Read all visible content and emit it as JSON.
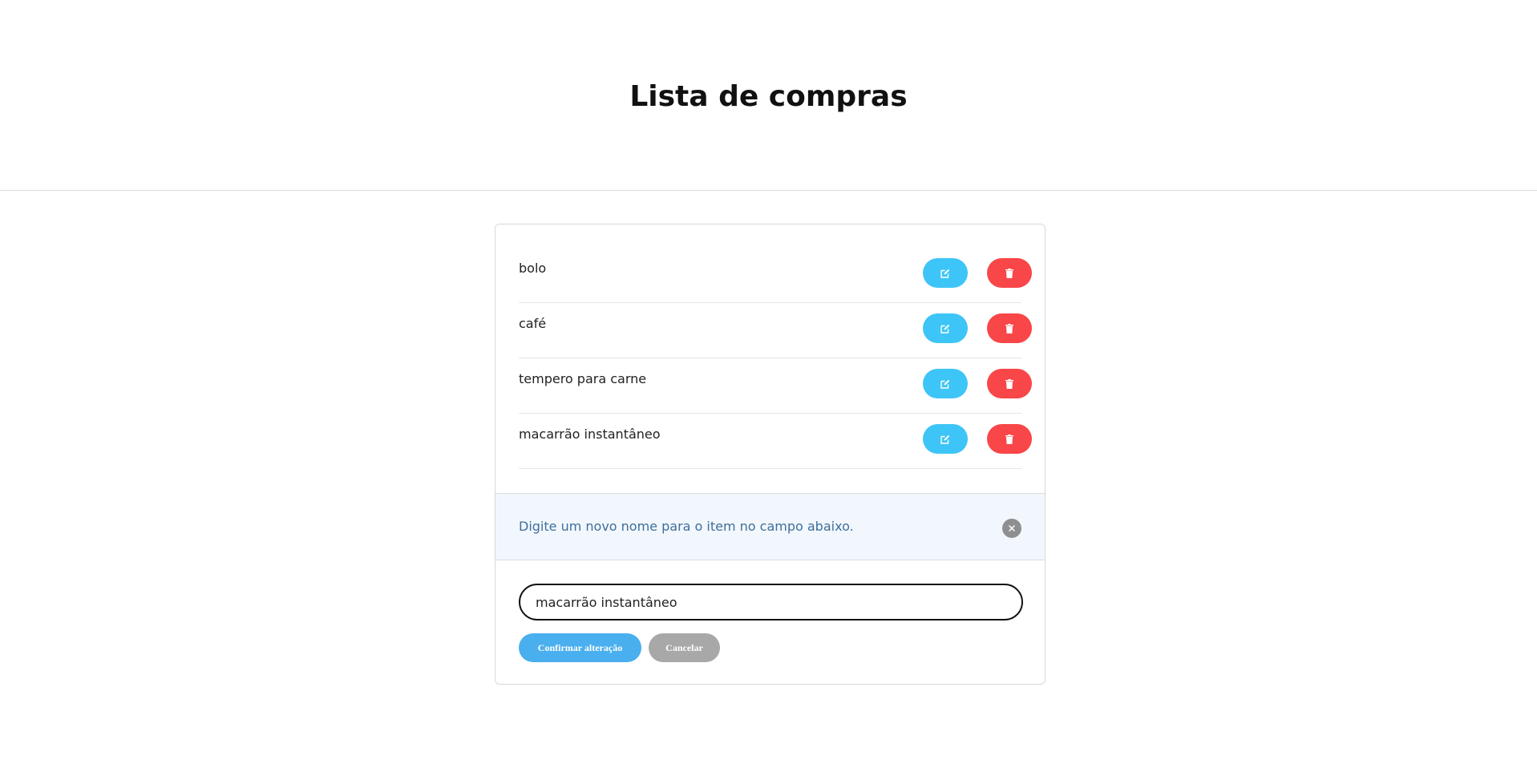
{
  "header": {
    "title": "Lista de compras"
  },
  "items": [
    {
      "label": "bolo"
    },
    {
      "label": "café"
    },
    {
      "label": "tempero para carne"
    },
    {
      "label": "macarrão instantâneo"
    }
  ],
  "alert": {
    "text": "Digite um novo nome para o item no campo abaixo."
  },
  "edit": {
    "value": "macarrão instantâneo",
    "confirm_label": "Confirmar alteração",
    "cancel_label": "Cancelar"
  },
  "colors": {
    "edit_button": "#3ec5f7",
    "delete_button": "#f94648",
    "confirm_button": "#4aafee",
    "cancel_button": "#a8a8a8",
    "alert_bg": "#f2f7fd",
    "alert_text": "#3e6f9c"
  },
  "icons": {
    "edit": "edit-icon",
    "delete": "trash-icon",
    "close": "close-icon"
  }
}
